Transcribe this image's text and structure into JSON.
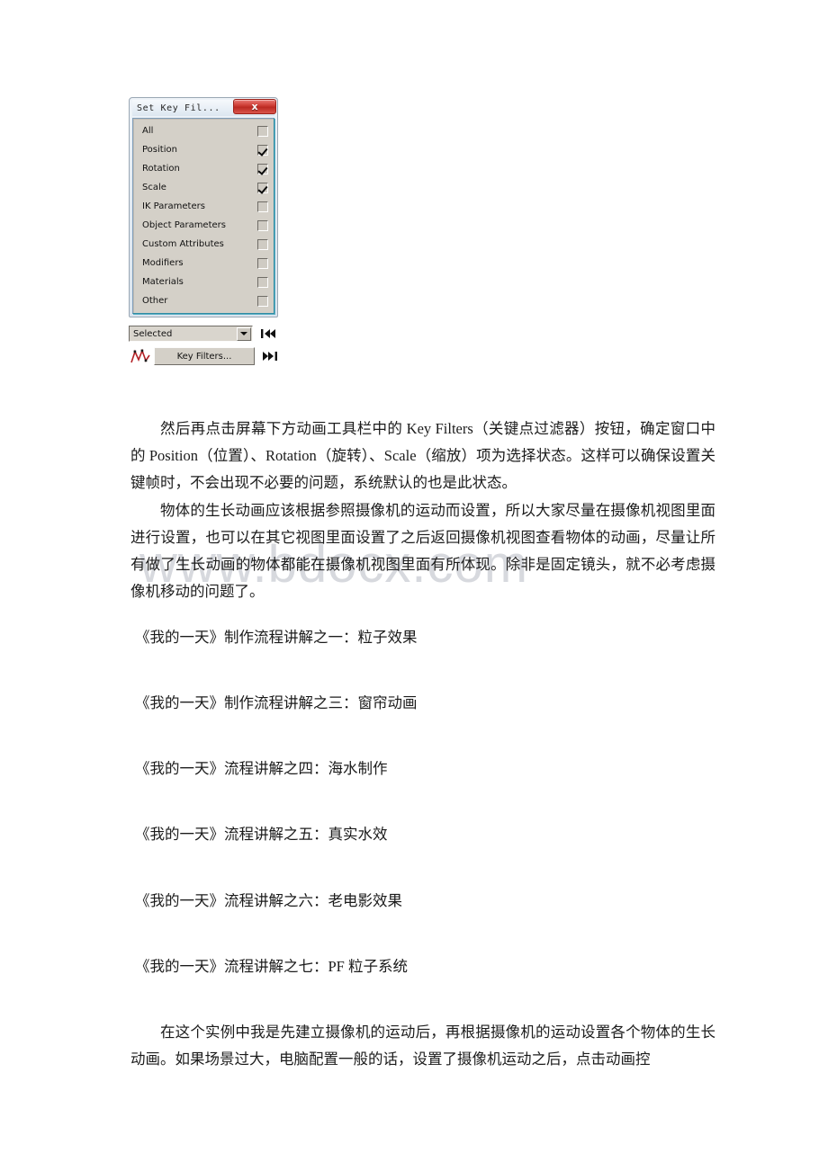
{
  "document": {
    "watermark": "www.bdocx.com",
    "paragraphs": [
      {
        "id": "p1",
        "text": "然后再点击屏幕下方动画工具栏中的 Key Filters（关键点过滤器）按钮，确定窗口中的 Position（位置）、Rotation（旋转）、Scale（缩放）项为选择状态。这样可以确保设置关键帧时，不会出现不必要的问题，系统默认的也是此状态。"
      },
      {
        "id": "p2",
        "text": "物体的生长动画应该根据参照摄像机的运动而设置，所以大家尽量在摄像机视图里面进行设置，也可以在其它视图里面设置了之后返回摄像机视图查看物体的动画，尽量让所有做了生长动画的物体都能在摄像机视图里面有所体现。除非是固定镜头，就不必考虑摄像机移动的问题了。"
      },
      {
        "id": "p3",
        "text": "在这个实例中我是先建立摄像机的运动后，再根据摄像机的运动设置各个物体的生长动画。如果场景过大，电脑配置一般的话，设置了摄像机运动之后，点击动画控"
      }
    ],
    "link_lines": [
      "《我的一天》制作流程讲解之一：粒子效果",
      "《我的一天》制作流程讲解之三：窗帘动画",
      "《我的一天》流程讲解之四：海水制作",
      "《我的一天》流程讲解之五：真实水效",
      "《我的一天》流程讲解之六：老电影效果",
      "《我的一天》流程讲解之七：PF 粒子系统"
    ]
  },
  "dialog": {
    "title": "Set Key Fil...",
    "close_label": "x",
    "close_icon": "close-icon",
    "filters": [
      {
        "label": "All",
        "checked": false
      },
      {
        "label": "Position",
        "checked": true
      },
      {
        "label": "Rotation",
        "checked": true
      },
      {
        "label": "Scale",
        "checked": true
      },
      {
        "label": "IK Parameters",
        "checked": false
      },
      {
        "label": "Object Parameters",
        "checked": false
      },
      {
        "label": "Custom Attributes",
        "checked": false
      },
      {
        "label": "Modifiers",
        "checked": false
      },
      {
        "label": "Materials",
        "checked": false
      },
      {
        "label": "Other",
        "checked": false
      }
    ]
  },
  "toolstrip": {
    "dropdown_value": "Selected",
    "dropdown_icon": "chevron-down-icon",
    "key_filters_label": "Key Filters...",
    "curve_icon": "function-curve-icon",
    "go_to_start_icon": "go-to-start-icon",
    "go_to_end_icon": "go-to-end-icon"
  },
  "colors": {
    "close_red": "#c8342b",
    "panel_grey": "#d4d0c8",
    "panel_border_teal": "#2e8ba3",
    "watermark_grey": "#d7d9de",
    "text_black": "#1b1b1b"
  }
}
